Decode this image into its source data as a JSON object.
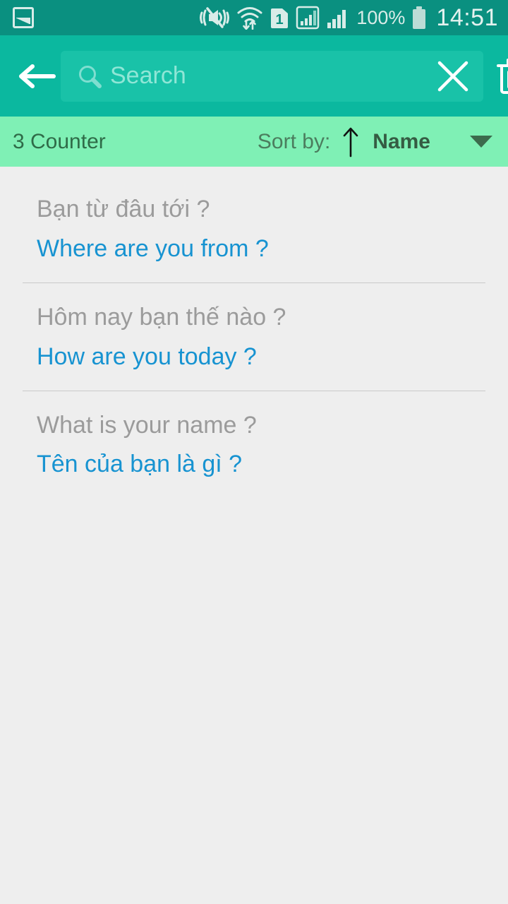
{
  "status_bar": {
    "gallery_icon": "gallery-icon",
    "mute_icon": "mute-vibrate-icon",
    "wifi_icon": "wifi-transfer-icon",
    "sim_icon": "sim-1-icon",
    "signal_icon_1": "signal-bars-boxed-icon",
    "signal_icon_2": "signal-bars-icon",
    "battery_percent": "100%",
    "battery_icon": "battery-full-icon",
    "time": "14:51",
    "background_color": "#0a9080"
  },
  "action_bar": {
    "back_icon": "back-arrow-icon",
    "search": {
      "value": "",
      "placeholder": "Search",
      "search_icon": "search-icon",
      "clear_icon": "close-x-icon"
    },
    "delete_icon": "trash-icon",
    "background_color": "#0bb89f"
  },
  "sort_bar": {
    "counter": "3 Counter",
    "sort_by_label": "Sort by:",
    "sort_direction_icon": "arrow-up-icon",
    "sort_value": "Name",
    "dropdown_icon": "chevron-down-icon",
    "background_color": "#7ff0b5"
  },
  "list": {
    "items": [
      {
        "source": "Bạn từ đâu tới ?",
        "target": "Where are you from ?"
      },
      {
        "source": "Hôm nay bạn thế nào ?",
        "target": "How are you today ?"
      },
      {
        "source": "What is your name ?",
        "target": "Tên của bạn là gì ?"
      }
    ],
    "source_color": "#9b9b9b",
    "target_color": "#1793d1",
    "background_color": "#eeeeee"
  }
}
